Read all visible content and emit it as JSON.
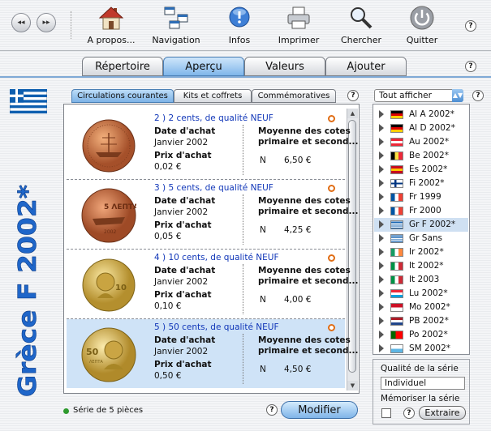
{
  "toolbar": {
    "back_glyph": "◂◂",
    "forward_glyph": "▸▸",
    "items": [
      {
        "label": "A propos...",
        "icon": "home-icon"
      },
      {
        "label": "Navigation",
        "icon": "navigation-icon"
      },
      {
        "label": "Infos",
        "icon": "info-icon"
      },
      {
        "label": "Imprimer",
        "icon": "printer-icon"
      },
      {
        "label": "Chercher",
        "icon": "magnifier-icon"
      },
      {
        "label": "Quitter",
        "icon": "power-icon"
      }
    ],
    "help": "?"
  },
  "main_tabs": [
    {
      "label": "Répertoire",
      "active": false
    },
    {
      "label": "Aperçu",
      "active": true
    },
    {
      "label": "Valeurs",
      "active": false
    },
    {
      "label": "Ajouter",
      "active": false
    }
  ],
  "series_title": "Grèce F 2002*",
  "sub_tabs": [
    {
      "label": "Circulations courantes",
      "active": true
    },
    {
      "label": "Kits et coffrets",
      "active": false
    },
    {
      "label": "Commémoratives",
      "active": false
    }
  ],
  "labels": {
    "date_achat": "Date d'achat",
    "prix_achat": "Prix d'achat",
    "moyenne_1": "Moyenne des cotes",
    "moyenne_2": "primaire et second..."
  },
  "coins": [
    {
      "title": "2 )     2 cents, de qualité NEUF",
      "date": "Janvier 2002",
      "price": "0,02 €",
      "grade": "N",
      "avg": "6,50 €",
      "selected": false
    },
    {
      "title": "3 )     5 cents, de qualité NEUF",
      "date": "Janvier 2002",
      "price": "0,05 €",
      "grade": "N",
      "avg": "4,25 €",
      "selected": false
    },
    {
      "title": "4 )     10 cents, de qualité NEUF",
      "date": "Janvier 2002",
      "price": "0,10 €",
      "grade": "N",
      "avg": "4,00 €",
      "selected": false
    },
    {
      "title": "5 )     50 cents, de qualité NEUF",
      "date": "Janvier 2002",
      "price": "0,50 €",
      "grade": "N",
      "avg": "4,50 €",
      "selected": true
    }
  ],
  "status": "Série de 5 pièces",
  "modify_button": "Modifier",
  "filter": {
    "selected": "Tout afficher"
  },
  "series_list": [
    {
      "name": "Al A 2002*",
      "flag": [
        "#000000",
        "#dd0000",
        "#ffce00"
      ],
      "dir": "h",
      "selected": false
    },
    {
      "name": "Al D 2002*",
      "flag": [
        "#000000",
        "#dd0000",
        "#ffce00"
      ],
      "dir": "h",
      "selected": false
    },
    {
      "name": "Au 2002*",
      "flag": [
        "#ed2939",
        "#ffffff",
        "#ed2939"
      ],
      "dir": "h",
      "selected": false
    },
    {
      "name": "Be 2002*",
      "flag": [
        "#000000",
        "#fae042",
        "#ed2939"
      ],
      "dir": "v",
      "selected": false
    },
    {
      "name": "Es 2002*",
      "flag": [
        "#c60b1e",
        "#ffc400",
        "#c60b1e"
      ],
      "dir": "h",
      "selected": false
    },
    {
      "name": "Fi 2002*",
      "flag": [
        "#ffffff",
        "#003580",
        "#ffffff"
      ],
      "dir": "cross",
      "selected": false
    },
    {
      "name": "Fr 1999",
      "flag": [
        "#0055a4",
        "#ffffff",
        "#ef4135"
      ],
      "dir": "v",
      "selected": false
    },
    {
      "name": "Fr 2000",
      "flag": [
        "#0055a4",
        "#ffffff",
        "#ef4135"
      ],
      "dir": "v",
      "selected": false
    },
    {
      "name": "Gr F 2002*",
      "flag": [
        "#0d5eaf",
        "#ffffff",
        "#0d5eaf"
      ],
      "dir": "gr",
      "selected": true
    },
    {
      "name": "Gr Sans",
      "flag": [
        "#0d5eaf",
        "#ffffff",
        "#0d5eaf"
      ],
      "dir": "gr",
      "selected": false
    },
    {
      "name": "Ir 2002*",
      "flag": [
        "#169b62",
        "#ffffff",
        "#ff883e"
      ],
      "dir": "v",
      "selected": false
    },
    {
      "name": "It 2002*",
      "flag": [
        "#009246",
        "#ffffff",
        "#ce2b37"
      ],
      "dir": "v",
      "selected": false
    },
    {
      "name": "It 2003",
      "flag": [
        "#009246",
        "#ffffff",
        "#ce2b37"
      ],
      "dir": "v",
      "selected": false
    },
    {
      "name": "Lu 2002*",
      "flag": [
        "#ed2939",
        "#ffffff",
        "#00a1de"
      ],
      "dir": "h",
      "selected": false
    },
    {
      "name": "Mo 2002*",
      "flag": [
        "#ce1126",
        "#ffffff",
        "#ce1126"
      ],
      "dir": "mo",
      "selected": false
    },
    {
      "name": "PB 2002*",
      "flag": [
        "#ae1c28",
        "#ffffff",
        "#21468b"
      ],
      "dir": "h",
      "selected": false
    },
    {
      "name": "Po 2002*",
      "flag": [
        "#006600",
        "#ff0000",
        "#ff0000"
      ],
      "dir": "po",
      "selected": false
    },
    {
      "name": "SM 2002*",
      "flag": [
        "#ffffff",
        "#5eb6e4",
        "#5eb6e4"
      ],
      "dir": "h2",
      "selected": false
    }
  ],
  "quality": {
    "label": "Qualité de la série",
    "value": "Individuel",
    "memorize": "Mémoriser la série",
    "extract_button": "Extraire"
  }
}
